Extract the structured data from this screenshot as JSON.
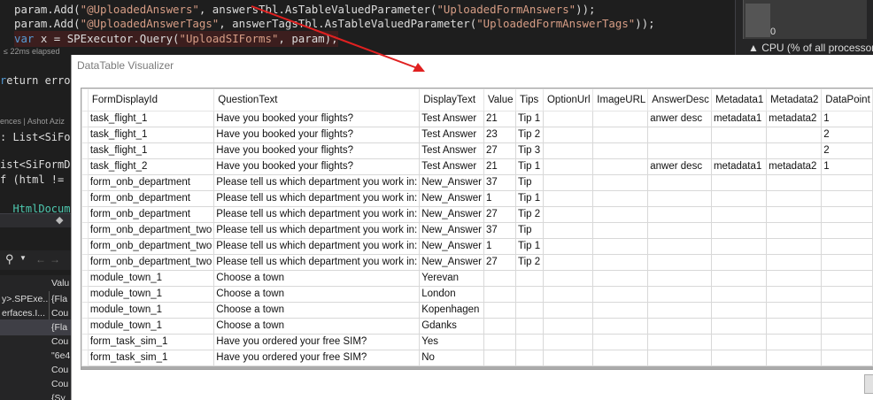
{
  "code": {
    "line1": {
      "p1": "param.Add(",
      "p2": "\"@UploadedAnswers\"",
      "p3": ", answersTbl.AsTableValuedParameter(",
      "p4": "\"UploadedFormAnswers\"",
      "p5": "));"
    },
    "line2": {
      "p1": "param.Add(",
      "p2": "\"@UploadedAnswerTags\"",
      "p3": ", answerTagsTbl.AsTableValuedParameter(",
      "p4": "\"UploadedFormAnswerTags\"",
      "p5": "));"
    },
    "line3": {
      "p1": "var",
      "p2": " x = SPExecutor.Query(",
      "p3": "\"UploadSIForms\"",
      "p4": ", param);"
    },
    "elapsed": "≤ 22ms elapsed"
  },
  "cpu": {
    "zero": "0",
    "label": "▲ CPU (% of all processors)"
  },
  "left_fragments": {
    "f1": "eturn errors",
    "refs": "ences | Ashot Aziz",
    "f2": ": List<SiFor",
    "f3": "ist<SiFormD",
    "f4": "f (html != n",
    "f5": "  HtmlDocum"
  },
  "locals": {
    "header": "Valu",
    "rows": [
      {
        "name": "y>.SPExe...",
        "value": "{Fla"
      },
      {
        "name": "erfaces.I...",
        "value": "Cou"
      },
      {
        "name": "",
        "value": "{Fla"
      },
      {
        "name": "",
        "value": "Cou"
      },
      {
        "name": "",
        "value": "\"6e4"
      },
      {
        "name": "",
        "value": "Cou"
      },
      {
        "name": "",
        "value": "Cou"
      },
      {
        "name": "",
        "value": "{Sy"
      }
    ]
  },
  "dialog": {
    "title": "DataTable Visualizer"
  },
  "table": {
    "columns": [
      "FormDisplayId",
      "QuestionText",
      "DisplayText",
      "Value",
      "Tips",
      "OptionUrl",
      "ImageURL",
      "AnswerDesc",
      "Metadata1",
      "Metadata2",
      "DataPoint"
    ],
    "rows": [
      [
        "task_flight_1",
        "Have you booked your flights?",
        "Test Answer",
        "21",
        "Tip 1",
        "",
        "",
        "anwer desc",
        "metadata1",
        "metadata2",
        "1"
      ],
      [
        "task_flight_1",
        "Have you booked your flights?",
        "Test Answer",
        "23",
        "Tip 2",
        "",
        "",
        "",
        "",
        "",
        "2"
      ],
      [
        "task_flight_1",
        "Have you booked your flights?",
        "Test Answer",
        "27",
        "Tip 3",
        "",
        "",
        "",
        "",
        "",
        "2"
      ],
      [
        "task_flight_2",
        "Have you booked your flights?",
        "Test Answer",
        "21",
        "Tip 1",
        "",
        "",
        "anwer desc",
        "metadata1",
        "metadata2",
        "1"
      ],
      [
        "form_onb_department",
        "Please tell us which department you work in:",
        "New_Answer",
        "37",
        "Tip",
        "",
        "",
        "",
        "",
        "",
        ""
      ],
      [
        "form_onb_department",
        "Please tell us which department you work in:",
        "New_Answer",
        "1",
        "Tip 1",
        "",
        "",
        "",
        "",
        "",
        ""
      ],
      [
        "form_onb_department",
        "Please tell us which department you work in:",
        "New_Answer",
        "27",
        "Tip 2",
        "",
        "",
        "",
        "",
        "",
        ""
      ],
      [
        "form_onb_department_two",
        "Please tell us which department you work in:",
        "New_Answer",
        "37",
        "Tip",
        "",
        "",
        "",
        "",
        "",
        ""
      ],
      [
        "form_onb_department_two",
        "Please tell us which department you work in:",
        "New_Answer",
        "1",
        "Tip 1",
        "",
        "",
        "",
        "",
        "",
        ""
      ],
      [
        "form_onb_department_two",
        "Please tell us which department you work in:",
        "New_Answer",
        "27",
        "Tip 2",
        "",
        "",
        "",
        "",
        "",
        ""
      ],
      [
        "module_town_1",
        "Choose a town",
        "Yerevan",
        "",
        "",
        "",
        "",
        "",
        "",
        "",
        ""
      ],
      [
        "module_town_1",
        "Choose a town",
        "London",
        "",
        "",
        "",
        "",
        "",
        "",
        "",
        ""
      ],
      [
        "module_town_1",
        "Choose a town",
        "Kopenhagen",
        "",
        "",
        "",
        "",
        "",
        "",
        "",
        ""
      ],
      [
        "module_town_1",
        "Choose a town",
        "Gdanks",
        "",
        "",
        "",
        "",
        "",
        "",
        "",
        ""
      ],
      [
        "form_task_sim_1",
        "Have you ordered your free SIM?",
        "Yes",
        "",
        "",
        "",
        "",
        "",
        "",
        "",
        ""
      ],
      [
        "form_task_sim_1",
        "Have you ordered your free SIM?",
        "No",
        "",
        "",
        "",
        "",
        "",
        "",
        "",
        ""
      ]
    ]
  },
  "colors": {
    "ide_bg": "#1e1e1e",
    "arrow": "#e02020",
    "dialog_bg": "#ffffff",
    "grid_border": "#d8d8d8"
  },
  "icons": {
    "search": "search-icon",
    "dropdown": "chevron-down-icon",
    "back": "arrow-left-icon",
    "forward": "arrow-right-icon",
    "pin": "pin-icon"
  }
}
